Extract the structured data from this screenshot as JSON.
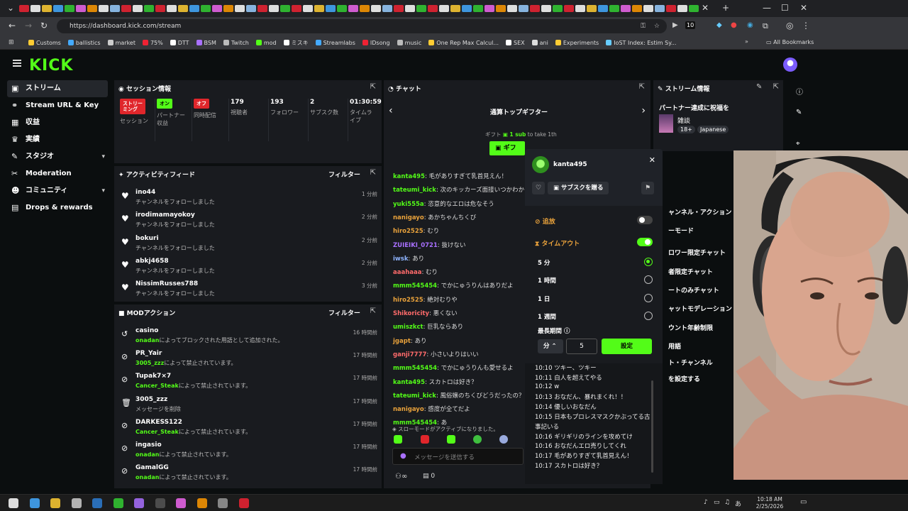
{
  "browser": {
    "url": "https://dashboard.kick.com/stream",
    "bookmarks": [
      "Customs",
      "ballistics",
      "market",
      "75%",
      "DTT",
      "BSM",
      "Twitch",
      "mod",
      "ミスキ",
      "Streamlabs",
      "IDsong",
      "music",
      "One Rep Max Calcul...",
      "SEX",
      "ani",
      "Experiments",
      "IoST Index: Estim Sy..."
    ],
    "all_bookmarks": "All Bookmarks",
    "ext_count": "10"
  },
  "header": {
    "logo": "KICK"
  },
  "sidebar": {
    "items": [
      {
        "label": "ストリーム",
        "icon": "stream-icon",
        "glyph": "▣",
        "active": true
      },
      {
        "label": "Stream URL & Key",
        "icon": "link-icon",
        "glyph": "⚭"
      },
      {
        "label": "収益",
        "icon": "revenue-icon",
        "glyph": "▦"
      },
      {
        "label": "実績",
        "icon": "trophy-icon",
        "glyph": "♛"
      },
      {
        "label": "スタジオ",
        "icon": "studio-icon",
        "glyph": "✎",
        "chevron": true
      },
      {
        "label": "Moderation",
        "icon": "wrench-icon",
        "glyph": "✂"
      },
      {
        "label": "コミュニティ",
        "icon": "community-icon",
        "glyph": "☻",
        "chevron": true
      },
      {
        "label": "Drops & rewards",
        "icon": "drops-icon",
        "glyph": "▤"
      }
    ]
  },
  "session": {
    "title": "セッション情報",
    "cells": [
      {
        "badge": "ストリーミング",
        "badge_color": "#e0262b",
        "label": "セッション"
      },
      {
        "badge": "オン",
        "badge_color": "#53fc18",
        "label": "パートナー収益"
      },
      {
        "badge": "オフ",
        "badge_color": "#e0262b",
        "label": "同時配信"
      },
      {
        "value": "179",
        "label": "視聴者"
      },
      {
        "value": "193",
        "label": "フォロワー"
      },
      {
        "value": "2",
        "label": "サブスク数"
      },
      {
        "value": "01:30:59",
        "label": "タイムライブ"
      }
    ]
  },
  "activity": {
    "title": "アクティビティフィード",
    "filter": "フィルター",
    "items": [
      {
        "name": "ino44",
        "action": "チャンネルをフォローしました",
        "time": "1 分前"
      },
      {
        "name": "irodimamayokoy",
        "action": "チャンネルをフォローしました",
        "time": "2 分前"
      },
      {
        "name": "bokuri",
        "action": "チャンネルをフォローしました",
        "time": "2 分前"
      },
      {
        "name": "abkj4658",
        "action": "チャンネルをフォローしました",
        "time": "2 分前"
      },
      {
        "name": "NissimRusses788",
        "action": "チャンネルをフォローしました",
        "time": "3 分前"
      }
    ]
  },
  "modactions": {
    "title": "MODアクション",
    "filter": "フィルター",
    "items": [
      {
        "name": "casino",
        "by": "onadan",
        "rest": "によってブロックされた用語として追加された。",
        "time": "16 時間前",
        "icon": "undo-icon",
        "glyph": "↺"
      },
      {
        "name": "PR_Yair",
        "by": "3005_zzz",
        "rest": "によって禁止されています。",
        "time": "17 時間前",
        "icon": "ban-icon",
        "glyph": "⊘"
      },
      {
        "name": "Tupak7×7",
        "by": "Cancer_Steak",
        "rest": "によって禁止されています。",
        "time": "17 時間前",
        "icon": "ban-icon",
        "glyph": "⊘"
      },
      {
        "name": "3005_zzz",
        "by": "",
        "rest": "メッセージを削除",
        "time": "17 時間前",
        "icon": "trash-icon",
        "glyph": "🗑"
      },
      {
        "name": "DARKESS122",
        "by": "Cancer_Steak",
        "rest": "によって禁止されています。",
        "time": "17 時間前",
        "icon": "ban-icon",
        "glyph": "⊘"
      },
      {
        "name": "ingasio",
        "by": "onadan",
        "rest": "によって禁止されています。",
        "time": "17 時間前",
        "icon": "ban-icon",
        "glyph": "⊘"
      },
      {
        "name": "GamalGG",
        "by": "onadan",
        "rest": "によって禁止されています。",
        "time": "17 時間前",
        "icon": "ban-icon",
        "glyph": "⊘"
      }
    ]
  },
  "chat": {
    "title": "チャット",
    "gifter_title": "通算トップギフター",
    "gift_line_pre": "ギフト",
    "gift_line_sub": "1 sub",
    "gift_line_post": "to take 1th",
    "gift_button": "ギフ",
    "messages": [
      {
        "user": "kanta495",
        "color": "#53fc18",
        "text": "毛がありすぎて乳首見えん！"
      },
      {
        "user": "tateumi_kick",
        "color": "#53fc18",
        "text": "次のキッカーズ面接いつかわかる人"
      },
      {
        "user": "yuki555a",
        "color": "#53fc18",
        "text": "恣意的なエロは危なそう"
      },
      {
        "user": "nanigayo",
        "color": "#e9a23b",
        "text": "あかちゃんちくび"
      },
      {
        "user": "hiro2525",
        "color": "#e9a23b",
        "text": "むり"
      },
      {
        "user": "ZUIEIKI_0721",
        "color": "#a970ff",
        "text": "抜けない"
      },
      {
        "user": "iwsk",
        "color": "#8fb4ff",
        "text": "あり"
      },
      {
        "user": "aaahaaa",
        "color": "#ff6b6b",
        "text": "むり"
      },
      {
        "user": "mmm545454",
        "color": "#53fc18",
        "text": "でかにゅうりんはありだよ"
      },
      {
        "user": "hiro2525",
        "color": "#e9a23b",
        "text": "絶対むりや"
      },
      {
        "user": "Shikoricity",
        "color": "#ff6b6b",
        "text": "悪くない"
      },
      {
        "user": "umiszkct",
        "color": "#53fc18",
        "text": "巨乳ならあり"
      },
      {
        "user": "jgapt",
        "color": "#e9a23b",
        "text": "あり"
      },
      {
        "user": "ganji7777",
        "color": "#ff6b6b",
        "text": "小さいよりはいい"
      },
      {
        "user": "mmm545454",
        "color": "#53fc18",
        "text": "でかにゅうりんも愛せるよ"
      },
      {
        "user": "kanta495",
        "color": "#53fc18",
        "text": "スカトロは好き？"
      },
      {
        "user": "tateumi_kick",
        "color": "#53fc18",
        "text": "風俗嬢のちくびどうだったの？"
      },
      {
        "user": "nanigayo",
        "color": "#e9a23b",
        "text": "感度が全てだよ"
      },
      {
        "user": "mmm545454",
        "color": "#53fc18",
        "text": "あ"
      }
    ],
    "slowmode": "スローモードがアクティブになりました。",
    "placeholder": "メッセージを送信する",
    "bottom_count": "0"
  },
  "popup": {
    "username": "kanta495",
    "gift_sub": "サブスクを贈る",
    "ban_label": "追放",
    "timeout_label": "タイムアウト",
    "options": [
      {
        "label": "5 分",
        "selected": true
      },
      {
        "label": "1 時間",
        "selected": false
      },
      {
        "label": "1 日",
        "selected": false
      },
      {
        "label": "1 週間",
        "selected": false
      }
    ],
    "max_period": "最長期間",
    "unit": "分",
    "value": "5",
    "set_button": "設定",
    "log": [
      "10:10 ツキー、ツキー",
      "10:11 白人を超えてやる",
      "10:12 w",
      "10:13 おなだん、暴れまくれ！！",
      "10:14 優しいおなだん",
      "10:15 日本もプロレスマスクかぶってる古",
      "事記いる",
      "10:16 ギリギリのラインを攻めてけ",
      "10:16 おなだんエロ売りしてくれ",
      "10:17 毛がありすぎて乳首見えん！",
      "10:17 スカトロは好き？"
    ]
  },
  "streaminfo": {
    "title": "ストリーム情報",
    "subtitle": "パートナー達成に祝福を",
    "category": "雑談",
    "tags": [
      "18+",
      "Japanese"
    ],
    "channel_items": [
      "ャンネル・アクション",
      "ーモード",
      "ロワー限定チャット",
      "者限定チャット",
      "ートのみチャット",
      "ャットモデレーション",
      "ウント年齢制限",
      "用語",
      "ト・チャンネル",
      "を設定する"
    ]
  },
  "taskbar": {
    "time": "10:18 AM",
    "date": "2/25/2026",
    "ime": "あ"
  }
}
